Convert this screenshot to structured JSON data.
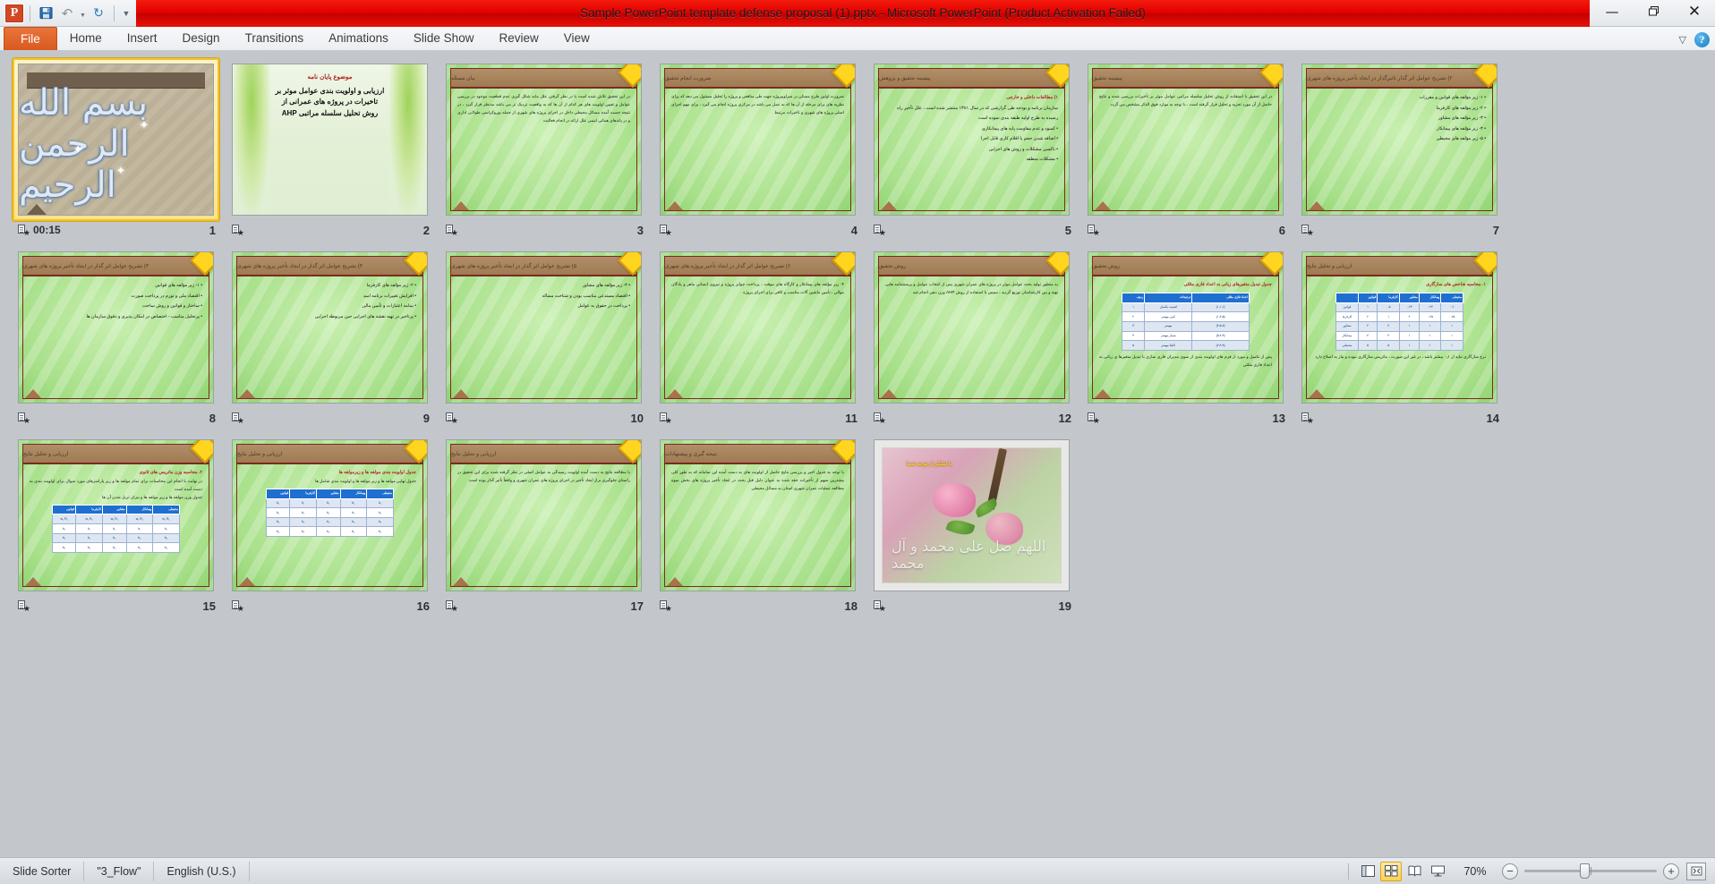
{
  "app": {
    "title": "Sample PowerPoint template defense proposal (1).pptx  -  Microsoft PowerPoint (Product Activation Failed)",
    "logo_letter": "P",
    "accent_red": "#e00000",
    "accent_orange": "#d95a1e",
    "selection_yellow": "#f2c231"
  },
  "quick_access": {
    "save_icon": "save-icon",
    "undo_icon": "undo-icon",
    "redo_icon": "redo-icon",
    "customize_icon": "customize-qat-icon"
  },
  "window_controls": {
    "minimize": "—",
    "restore": "❐",
    "close": "✕"
  },
  "ribbon": {
    "tabs": [
      {
        "label": "File"
      },
      {
        "label": "Home"
      },
      {
        "label": "Insert"
      },
      {
        "label": "Design"
      },
      {
        "label": "Transitions"
      },
      {
        "label": "Animations"
      },
      {
        "label": "Slide Show"
      },
      {
        "label": "Review"
      },
      {
        "label": "View"
      }
    ],
    "collapse_icon": "chevron-up-icon",
    "help_label": "?"
  },
  "status": {
    "view_name": "Slide Sorter",
    "theme_name": "\"3_Flow\"",
    "language": "English (U.S.)",
    "zoom_level": "70%",
    "zoom_out_label": "−",
    "zoom_in_label": "+",
    "views": [
      {
        "name": "normal-view-button",
        "active": false
      },
      {
        "name": "slide-sorter-view-button",
        "active": true
      },
      {
        "name": "reading-view-button",
        "active": false
      },
      {
        "name": "slide-show-button",
        "active": false
      }
    ],
    "fit_label": "fit-slide-to-window-button"
  },
  "sorter": {
    "selected_slide": 1,
    "slides": [
      {
        "number": "1",
        "kind": "bismillah",
        "selected": true,
        "has_transition": true,
        "has_animation": false,
        "timing": "00:15",
        "calligraphy": "بسم الله الرحمن الرحیم"
      },
      {
        "number": "2",
        "kind": "title-green",
        "has_transition": true,
        "has_animation": false,
        "timing": "",
        "line1": "موضوع پایان نامه",
        "line2": "ارزیابی و اولویت بندی عوامل موثر بر تاخیرات در پروژه های عمرانی از روش تحلیل سلسله مراتبی AHP"
      },
      {
        "number": "3",
        "kind": "green-text",
        "has_transition": true,
        "has_animation": true,
        "timing": "",
        "header": "بیان مسئله",
        "body": "در این تحقیق تلاش شده است با در نظر گرفتن علل مایه شکل گیری عدم قطعیت موجود در بررسی عوامل و تعیین اولویت های هر کدام از آن ها که به واقعیت نزدیک تر می باشد مدنظر قرار گیرد ، در نتیجه جست آمده مسائل محیطی داخل در اجرای پروژه های شهری از جمله بوروکراسی طولانی اداری و در پاندهای هماتی اینمی علل ارائه در انجام فعالیت"
      },
      {
        "number": "4",
        "kind": "green-text",
        "has_transition": true,
        "has_animation": true,
        "timing": "",
        "header": "ضرورت انجام تحقیق",
        "body": "ضرورت اولین طرح مسکن در سراویپروژه جهت طی منافعی و پروژه را تحلیل مسئول می دهد که پرای نظریه های برای مرحله از آن ها که به عمل می باشد در مرکزی پروژه انجام می گیرد ، برای مهم اجرای اصلی پروژه های شهری و تاخیرات مرتبط"
      },
      {
        "number": "5",
        "kind": "green-bullets",
        "has_transition": true,
        "has_animation": true,
        "timing": "",
        "header": "پیشینه تحقیق و پژوهش",
        "subtitle": "۱) مطالعات داخلی و خارجی",
        "intro": "سازمان برنامه و بودجه طی گزارشی که در سال ۱۳۸۱ منتشر شده است ، علل تأخیر راه رسیده به طرح اولیه طبقه بندی نموده است",
        "bullets": [
          "کمبود و عدم مقاومت پایه های پیمانکاری",
          "اضافه شدن حجم یا اقلام کاری قابل اجرا",
          "ناکسی مشکلات و روش های اجرایی",
          "مشکلات منطقه"
        ]
      },
      {
        "number": "6",
        "kind": "green-text",
        "has_transition": true,
        "has_animation": true,
        "timing": "",
        "header": "پیشینه تحقیق",
        "body": "در این تحقیق با استفاده از روش تحلیل سلسله مراتبی عوامل موثر بر تأخیرات بررسی شده و نتایج حاصل از آن مورد تجزیه و تحلیل قرار گرفته است ، با توجه به موارد فوق الذکر مشخص می گردد"
      },
      {
        "number": "7",
        "kind": "green-bullets",
        "has_transition": true,
        "has_animation": true,
        "timing": "",
        "header": "۲) تشریح عوامل اثر گذار تاثیرگذار در ایجاد تأخیر پروژه های شهری",
        "bullets": [
          "۱- زیر مؤلفه های قوانین و مقررات",
          "۲- زیر مؤلفه های کارفرما",
          "۳- زیر مؤلفه های مشاور",
          "۴- زیر مؤلفه های پیمانکار",
          "۵- زیر مؤلفه های محیطی"
        ]
      },
      {
        "number": "8",
        "kind": "green-bullets",
        "has_transition": true,
        "has_animation": true,
        "timing": "",
        "header": "۳) تشریح عوامل اثر گذار در ایجاد تأخیر پروژه های شهری",
        "bullets": [
          "۱- زیر مؤلفه های قوانین",
          "اقتصاد ملی و تورم در پرداخت صورت",
          "ساختار و قوانین و روش ساخت",
          "پرتحلیل مناسب - اختصاص در امکان پذیری و دقوق سازمان ها"
        ]
      },
      {
        "number": "9",
        "kind": "green-bullets",
        "has_transition": true,
        "has_animation": true,
        "timing": "",
        "header": "۴) تشریح عوامل اثر گذار در ایجاد تأخیر پروژه های شهری",
        "bullets": [
          "۲- زیر مؤلفه های کارفرما",
          "افزایش تغییرات برنامه امید",
          "بینامه اعتبارات و تأمین مالی",
          "پرتاخیر در تهیه نقشه های اجرایی حین مربوطه اجرایی"
        ]
      },
      {
        "number": "10",
        "kind": "green-bullets",
        "has_transition": true,
        "has_animation": true,
        "timing": "",
        "header": "۵) تشریح عوامل اثر گذار در ایجاد تأخیر پروژه های شهری",
        "bullets": [
          "۳- زیر مؤلفه های مشاور",
          "اقتصاد مستدعی مناسب بودن و شناخت مساله",
          "پرداخت در حقوق به عوامل"
        ]
      },
      {
        "number": "11",
        "kind": "green-text",
        "has_transition": true,
        "has_animation": true,
        "timing": "",
        "header": "۶) تشریح عوامل اثر گذار در ایجاد تأخیر پروژه های شهری",
        "body": "۴- زیر مؤلفه های پیمانکار و کارگاه های موقت ، پرداخت جوابز پروژه و نیروی انسانی ماهر و پادگان موالی ، تأمین ماشین آلات مناسب و کافی برای اجرای پروژه"
      },
      {
        "number": "12",
        "kind": "green-text",
        "has_transition": true,
        "has_animation": true,
        "timing": "",
        "header": "روش تحقیق",
        "body": "به منظور تولید بحث عوامل موثر در پروژه های عمران شهری پس از انتخاب عوامل و پرسشنامه هایی تهیه و بین کارشناسان توزیع گردید ، سپس با استفاده از روش AHP وزن دهی انجام شد"
      },
      {
        "number": "13",
        "kind": "green-table",
        "has_transition": true,
        "has_animation": true,
        "timing": "",
        "header": "روش تحقیق",
        "table_title": "جدول تبدیل متغیرهای زبانی به اعداد فازی مثلثی",
        "table": {
          "headers": [
            "اعداد فازی مثلثی",
            "ترجیحات",
            "ردیف"
          ],
          "rows": [
            [
              "(۱،۱،۱)",
              "اهمیت یکسان",
              "۱"
            ],
            [
              "(۱،۳،۵)",
              "کمی مهمتر",
              "۲"
            ],
            [
              "(۳،۵،۷)",
              "مهمتر",
              "۳"
            ],
            [
              "(۵،۷،۹)",
              "بسیار مهمتر",
              "۴"
            ],
            [
              "(۷،۹،۹)",
              "کاملا مهمتر",
              "۵"
            ]
          ]
        },
        "body": "پس از تکمیل و مورد از فرم های اولویت بندی از سوی مدیران فازی سازی با تبدیل متغیرها ی زبانی به اعداد فازی مثلثی"
      },
      {
        "number": "14",
        "kind": "green-table",
        "has_transition": true,
        "has_animation": true,
        "timing": "",
        "header": "ارزیابی و تحلیل نتایج",
        "table_title": "۱.  محاسبه شاخص های سازگاری",
        "table": {
          "headers": [
            "محیطی",
            "پیمانکار",
            "مشاور",
            "کارفرما",
            "قوانین",
            "-"
          ],
          "rows": [
            [
              "۰.۲",
              "۰.۲۳",
              "۰.۲۳",
              "۰.۵",
              "۱",
              "قوانین"
            ],
            [
              "۰.۲۵",
              "۰.۲۵",
              "۲",
              "۱",
              "۲",
              "کارفرما"
            ],
            [
              "۱",
              "۱",
              "۱",
              "۴",
              "۴",
              "مشاور"
            ],
            [
              "۱",
              "۱",
              "۱",
              "۴",
              "۴",
              "پیمانکار"
            ],
            [
              "۱",
              "۱",
              "۱",
              "۵",
              "۵",
              "محیطی"
            ]
          ]
        },
        "body": "نرخ سازگاری نباید از ۰٫۱ بیشتر باشد ، در غیر این صورت ، ماتریس سازگاری نبوده و نیاز به اصلاح دارد"
      },
      {
        "number": "15",
        "kind": "green-table",
        "has_transition": true,
        "has_animation": true,
        "timing": "",
        "header": "ارزیابی و تحلیل نتایج",
        "table_title": "۲. محاسبه وزن ماتریس های ثانوی",
        "intro": "در نهایت با انجام این محاسبات برای تمام مولفه ها و زیر پارامترهای مورد سوال برای اولویت بندی به دست آمده است",
        "table_caption": "جدول وزن مولفه ها و زیر مولفه ها و نیزان تربل شدن آن ها",
        "table": {
          "headers": [
            "محیطی",
            "پیمانکار",
            "مشاور",
            "کارفرما",
            "قوانین"
          ],
          "rows": [
            [
              "w₁  R₁",
              "w₁  R₁",
              "w₁  R₁",
              "w₁  R₁",
              "w₁  R₁"
            ],
            [
              "b₁",
              "b₁",
              "b₁",
              "b₁",
              "b₁"
            ],
            [
              "b₂",
              "b₂",
              "b₂",
              "b₂",
              "b₂"
            ],
            [
              "b₃",
              "b₃",
              "b₃",
              "b₃",
              "b₃"
            ]
          ]
        }
      },
      {
        "number": "16",
        "kind": "green-table",
        "has_transition": true,
        "has_animation": true,
        "timing": "",
        "header": "ارزیابی و تحلیل نتایج",
        "table_title": "جدول اولویت بندی مولفه ها و زیرمولفه ها",
        "intro": "جدول نهایی مولفه ها و زیر مولفه ها و اولویت بندی شامل ها",
        "table": {
          "headers": [
            "محیطی",
            "پیمانکار",
            "مشاور",
            "کارفرما",
            "قوانین"
          ],
          "rows": [
            [
              "b₁",
              "b₁",
              "b₁",
              "b₁",
              "b₁"
            ],
            [
              "b₂",
              "b₂",
              "b₂",
              "b₂",
              "b₂"
            ],
            [
              "b₃",
              "b₃",
              "b₃",
              "b₃",
              "b₃"
            ],
            [
              "b₄",
              "b₄",
              "b₄",
              "b₄",
              "b₄"
            ]
          ]
        }
      },
      {
        "number": "17",
        "kind": "green-text",
        "has_transition": true,
        "has_animation": true,
        "timing": "",
        "header": "ارزیابی و تحلیل نتایج",
        "body": "با مطالعه نتایج به دست آمده اولویت رسیدگی به عوامل اصلی در نظر گرفته شده برای این تحقیق در راستای جلوگیری براز ایجاد تأخیر در اجرای پروژه های عمران شهری و وافقاً تأثیر گذار بوده است"
      },
      {
        "number": "18",
        "kind": "green-text",
        "has_transition": true,
        "has_animation": true,
        "timing": "",
        "header": "نتیجه گیری و پیشنهادات",
        "body": "با توجه به جدول اخیر و بررسی نتایج حاصل از اولویت های به دست آمده این سامانه که به طور کلی بیشترین سهم از تأخیرات حقه شده به عنوان دلیل قبل بحث در ایجاد تأخیر پروژه های بخش میوه مطالعه عملیات عمران شهری استان به مسائل محیطی"
      },
      {
        "number": "19",
        "kind": "photo",
        "has_transition": true,
        "has_animation": false,
        "timing": "",
        "thanks_text": "با تشکر از توجه شما",
        "signature": "اللهم صل علی محمد و آل محمد"
      }
    ]
  }
}
